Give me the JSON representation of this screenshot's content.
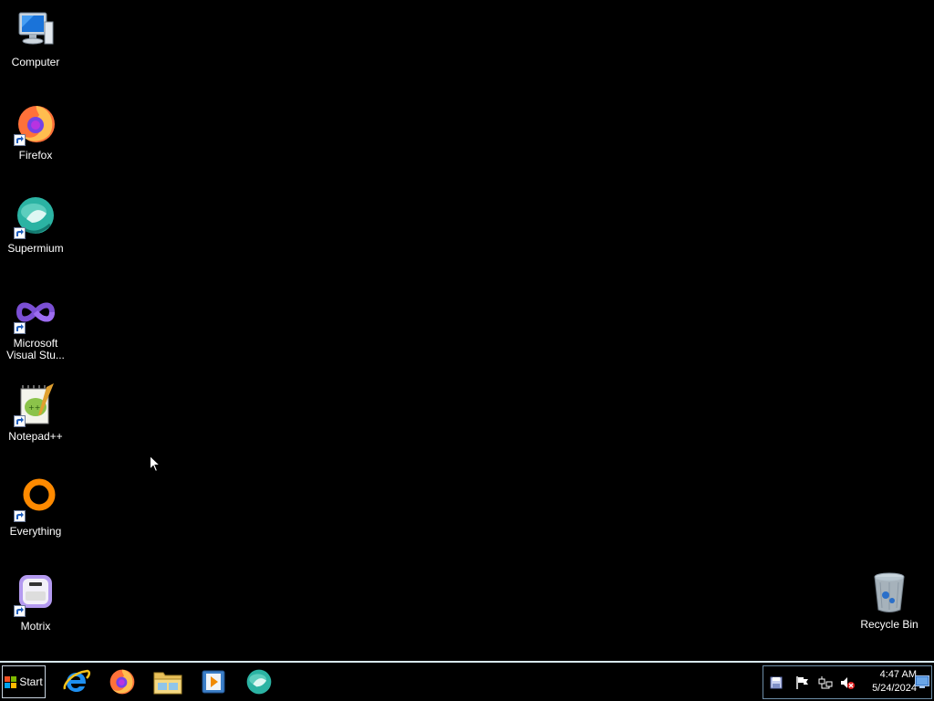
{
  "desktop": {
    "icons": [
      {
        "label": "Computer",
        "icon": "computer-icon"
      },
      {
        "label": "Firefox",
        "icon": "firefox-icon"
      },
      {
        "label": "Supermium",
        "icon": "supermium-icon"
      },
      {
        "label": "Microsoft Visual Stu...",
        "icon": "visual-studio-icon"
      },
      {
        "label": "Notepad++",
        "icon": "notepadpp-icon"
      },
      {
        "label": "Everything",
        "icon": "everything-icon"
      },
      {
        "label": "Motrix",
        "icon": "motrix-icon"
      },
      {
        "label": "Recycle Bin",
        "icon": "recycle-bin-icon"
      }
    ]
  },
  "taskbar": {
    "start_label": "Start",
    "pinned": [
      {
        "icon": "internet-explorer-icon"
      },
      {
        "icon": "firefox-icon"
      },
      {
        "icon": "file-explorer-icon"
      },
      {
        "icon": "media-player-icon"
      },
      {
        "icon": "supermium-icon"
      }
    ],
    "tray": {
      "icons": [
        "save-icon",
        "flag-icon",
        "network-icon",
        "volume-muted-icon"
      ],
      "time": "4:47 AM",
      "date": "5/24/2024"
    }
  },
  "colors": {
    "desktop_background": "#000000",
    "taskbar_border": "#d8e8f0"
  }
}
